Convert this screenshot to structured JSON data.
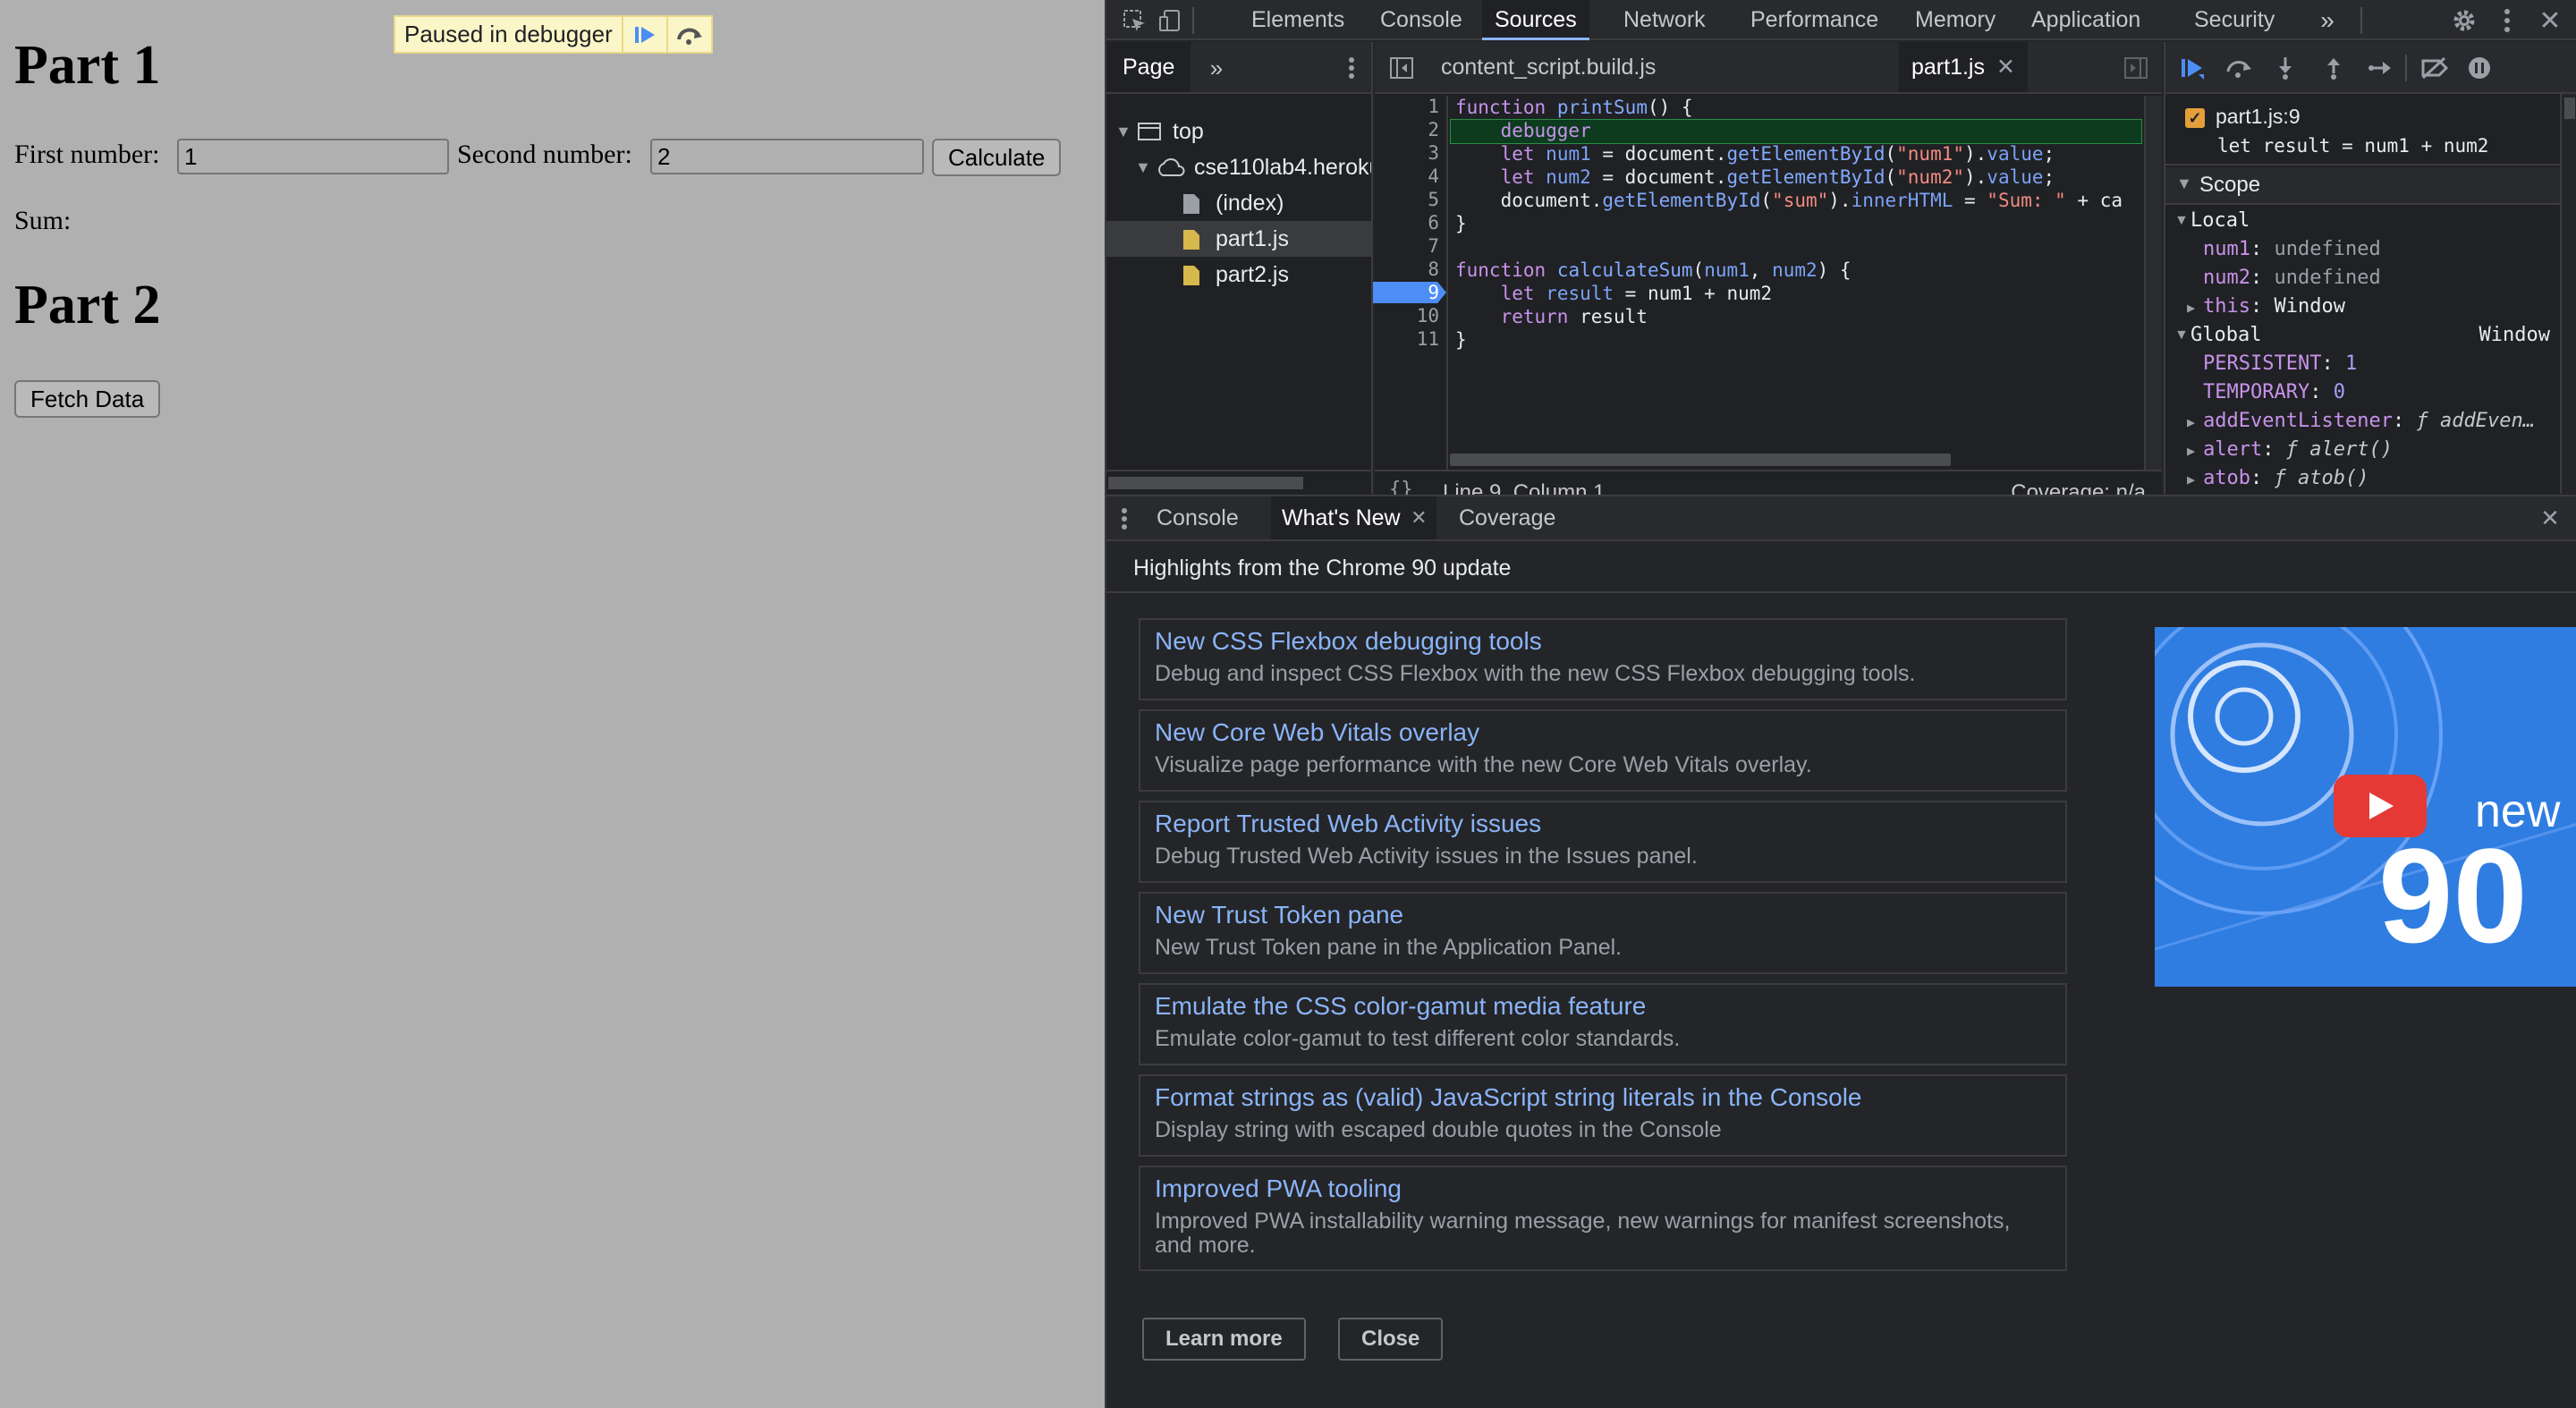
{
  "page": {
    "part1_heading": "Part 1",
    "first_label": "First number:",
    "first_value": "1",
    "second_label": "Second number:",
    "second_value": "2",
    "calculate_label": "Calculate",
    "sum_label": "Sum:",
    "part2_heading": "Part 2",
    "fetch_label": "Fetch Data",
    "paused_label": "Paused in debugger"
  },
  "devtools": {
    "tabs": [
      "Elements",
      "Console",
      "Sources",
      "Network",
      "Performance",
      "Memory",
      "Application",
      "Security"
    ],
    "active_tab": "Sources",
    "navigator": {
      "tab": "Page",
      "items": [
        {
          "label": "top"
        },
        {
          "label": "cse110lab4.herokuapp.com"
        },
        {
          "label": "(index)"
        },
        {
          "label": "part1.js"
        },
        {
          "label": "part2.js"
        }
      ]
    },
    "editor": {
      "tabs": [
        "content_script.build.js",
        "part1.js"
      ],
      "active_tab": "part1.js",
      "line_numbers": [
        "1",
        "2",
        "3",
        "4",
        "5",
        "6",
        "7",
        "8",
        "9",
        "10",
        "11"
      ],
      "breakpoint_line": "9",
      "status_position": "Line 9, Column 1",
      "coverage": "Coverage: n/a"
    },
    "debugger": {
      "breakpoint_file": "part1.js:9",
      "breakpoint_code": "let result = num1 + num2",
      "scope_title": "Scope",
      "local_title": "Local",
      "global_title": "Global",
      "global_value": "Window",
      "local_vars": [
        {
          "name": "num1",
          "value": "undefined"
        },
        {
          "name": "num2",
          "value": "undefined"
        },
        {
          "name": "this",
          "value": "Window"
        }
      ],
      "global_vars": [
        {
          "name": "PERSISTENT",
          "value": "1"
        },
        {
          "name": "TEMPORARY",
          "value": "0"
        },
        {
          "name": "addEventListener",
          "value": "ƒ addEven…"
        },
        {
          "name": "alert",
          "value": "ƒ alert()"
        },
        {
          "name": "atob",
          "value": "ƒ atob()"
        }
      ]
    },
    "drawer": {
      "tabs": [
        "Console",
        "What's New",
        "Coverage"
      ],
      "active_tab": "What's New",
      "heading": "Highlights from the Chrome 90 update",
      "features": [
        {
          "title": "New CSS Flexbox debugging tools",
          "desc": "Debug and inspect CSS Flexbox with the new CSS Flexbox debugging tools."
        },
        {
          "title": "New Core Web Vitals overlay",
          "desc": "Visualize page performance with the new Core Web Vitals overlay."
        },
        {
          "title": "Report Trusted Web Activity issues",
          "desc": "Debug Trusted Web Activity issues in the Issues panel."
        },
        {
          "title": "New Trust Token pane",
          "desc": "New Trust Token pane in the Application Panel."
        },
        {
          "title": "Emulate the CSS color-gamut media feature",
          "desc": "Emulate color-gamut to test different color standards."
        },
        {
          "title": "Format strings as (valid) JavaScript string literals in the Console",
          "desc": "Display string with escaped double quotes in the Console"
        },
        {
          "title": "Improved PWA tooling",
          "desc": "Improved PWA installability warning message, new warnings for manifest screenshots, and more."
        }
      ],
      "learn_more": "Learn more",
      "close": "Close",
      "video_text_new": "new",
      "video_text_num": "90"
    }
  }
}
